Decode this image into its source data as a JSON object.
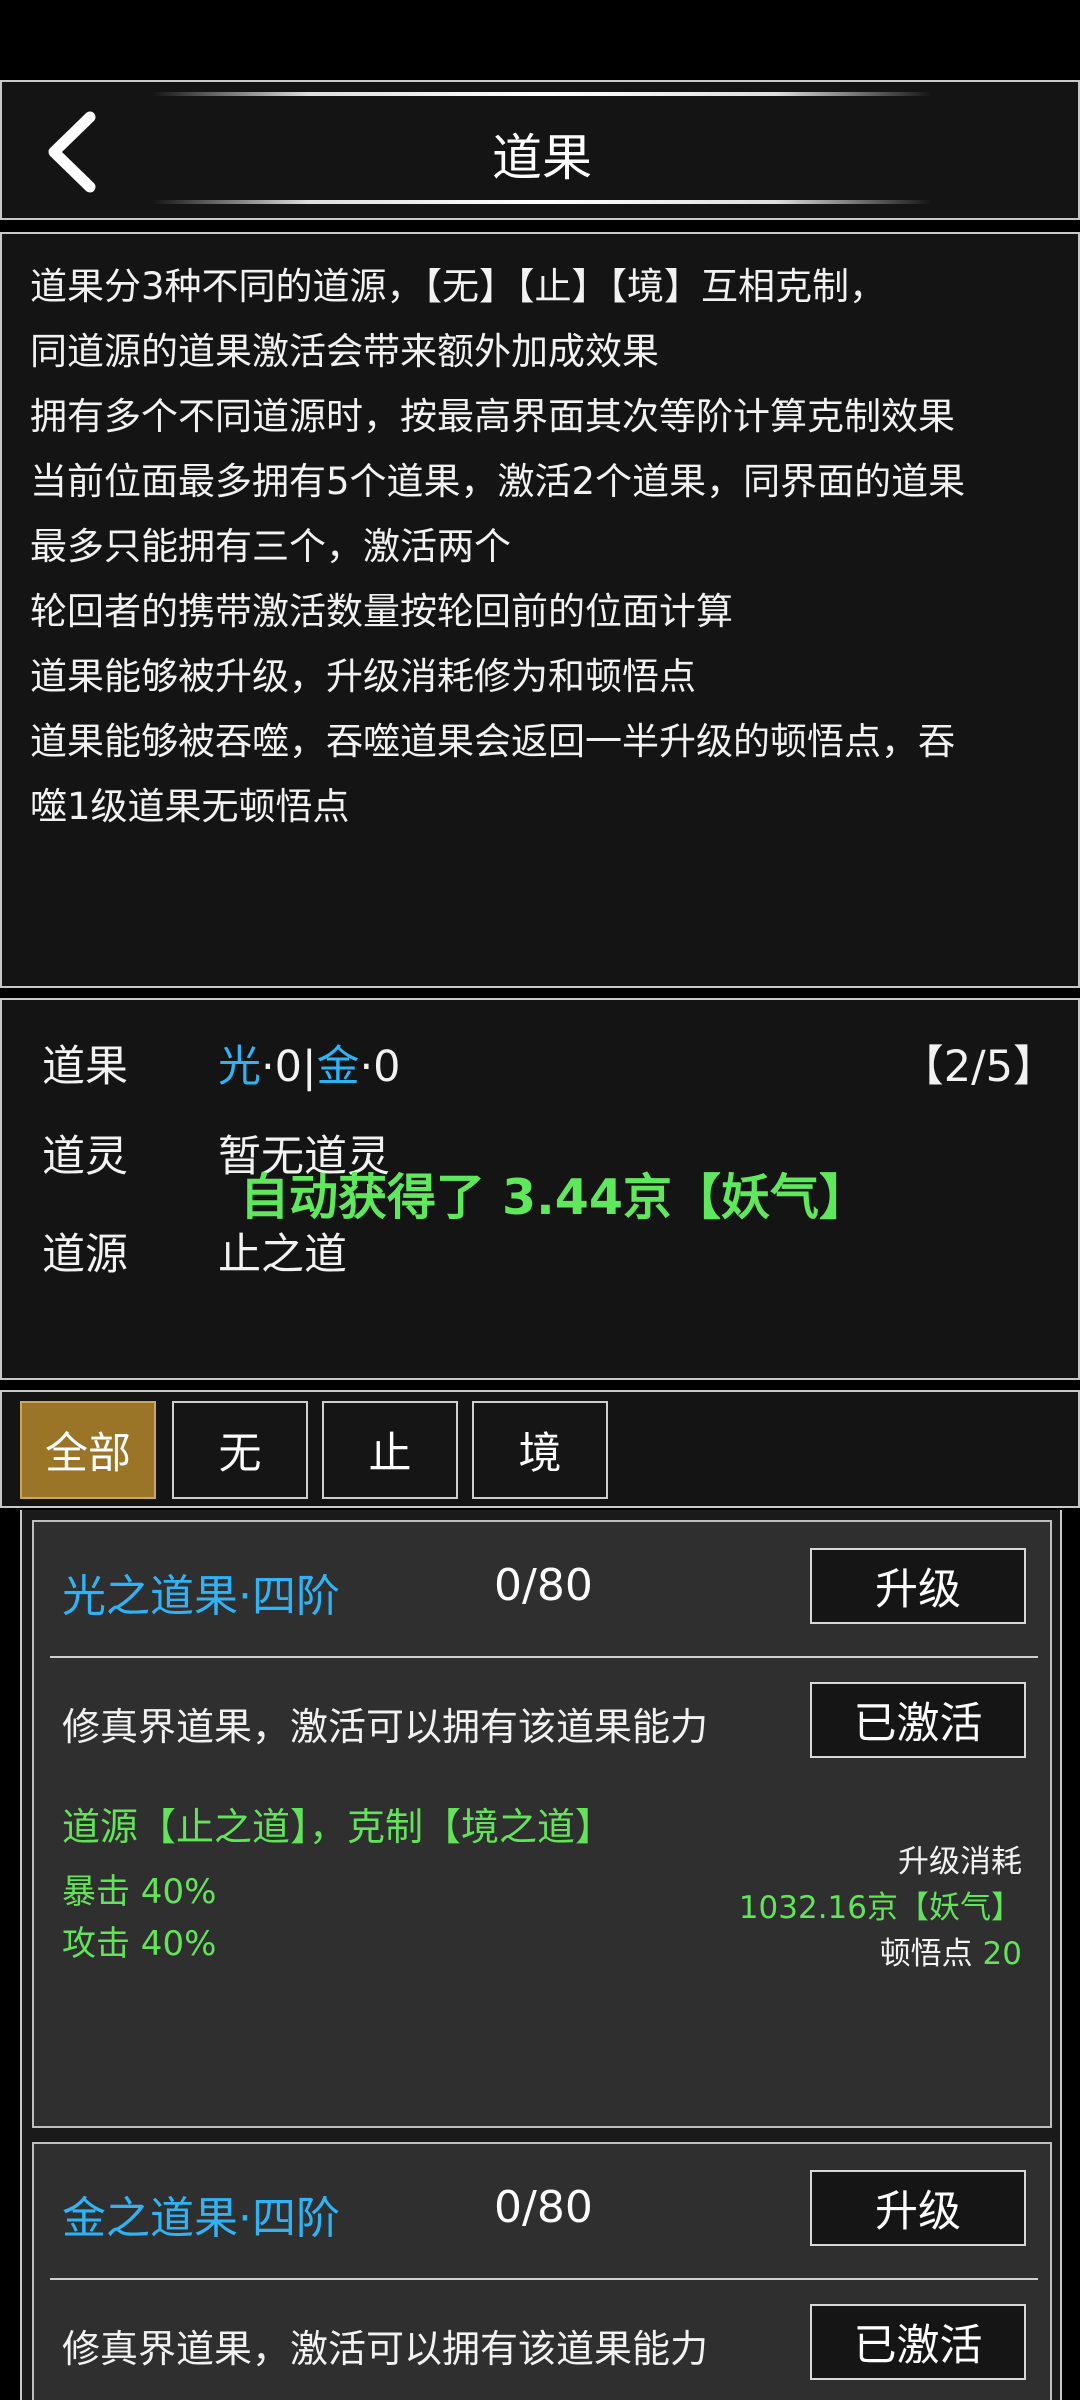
{
  "header": {
    "back_icon": "chevron-left-icon",
    "title": "道果"
  },
  "rules": [
    "道果分3种不同的道源，【无】【止】【境】互相克制，",
    "同道源的道果激活会带来额外加成效果",
    "拥有多个不同道源时，按最高界面其次等阶计算克制效果",
    "当前位面最多拥有5个道果，激活2个道果，同界面的道果",
    "最多只能拥有三个，激活两个",
    "轮回者的携带激活数量按轮回前的位面计算",
    "道果能够被升级，升级消耗修为和顿悟点",
    "道果能够被吞噬，吞噬道果会返回一半升级的顿悟点，吞",
    "噬1级道果无顿悟点"
  ],
  "status": {
    "daoguo_label": "道果",
    "daoguo_value": {
      "guang": "光",
      "dot1": "·0|",
      "jin": "金",
      "dot2": "·0"
    },
    "count": "【2/5】",
    "daoling_label": "道灵",
    "daoling_value": "暂无道灵",
    "daoyuan_label": "道源",
    "daoyuan_value": "止之道",
    "toast": "自动获得了 3.44京【妖气】"
  },
  "tabs": [
    {
      "label": "全部",
      "active": true
    },
    {
      "label": "无",
      "active": false
    },
    {
      "label": "止",
      "active": false
    },
    {
      "label": "境",
      "active": false
    }
  ],
  "cards": [
    {
      "name": "光之道果·四阶",
      "progress": "0/80",
      "upgrade_label": "升级",
      "desc": "修真界道果，激活可以拥有该道果能力",
      "activated_label": "已激活",
      "source": "道源【止之道】，克制【境之道】",
      "stat1": "暴击 40%",
      "stat2": "攻击 40%",
      "cost_title": "升级消耗",
      "cost_value": "1032.16京【妖气】",
      "insight_label": "顿悟点",
      "insight_value": "20"
    },
    {
      "name": "金之道果·四阶",
      "progress": "0/80",
      "upgrade_label": "升级",
      "desc": "修真界道果，激活可以拥有该道果能力",
      "activated_label": "已激活"
    }
  ],
  "colors": {
    "accent_blue": "#2fb3f5",
    "accent_green": "#62e35a",
    "tab_active": "#9a7427"
  }
}
